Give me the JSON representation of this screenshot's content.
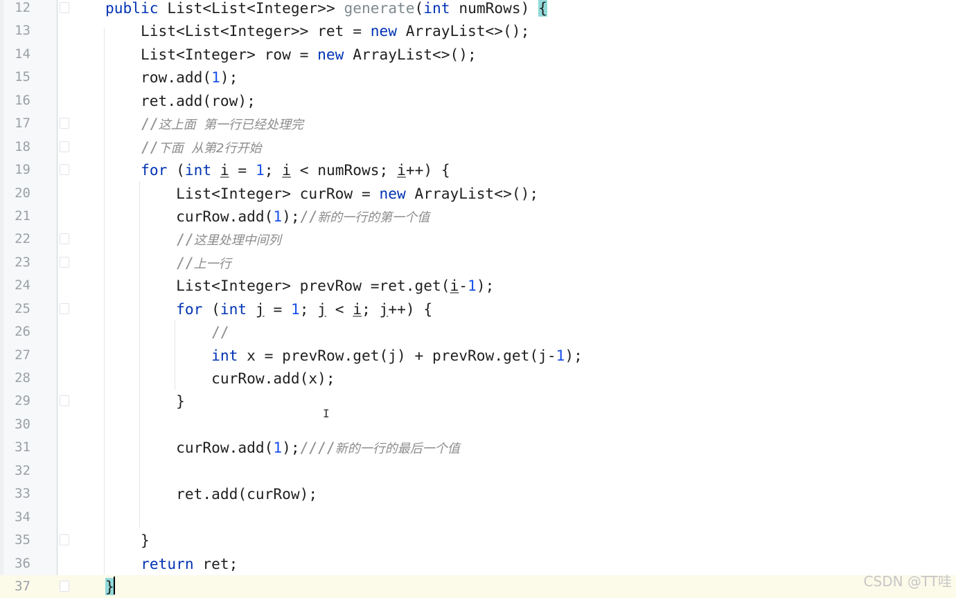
{
  "editor": {
    "current_line": 37,
    "lines": [
      {
        "num": "12",
        "fold": true,
        "tokens": [
          {
            "t": "    "
          },
          {
            "t": "public",
            "c": "kw"
          },
          {
            "t": " List<List<Integer>> "
          },
          {
            "t": "generate",
            "c": "fn"
          },
          {
            "t": "("
          },
          {
            "t": "int",
            "c": "kw"
          },
          {
            "t": " numRows) "
          },
          {
            "t": "{",
            "c": "br"
          }
        ]
      },
      {
        "num": "13",
        "tokens": [
          {
            "t": "        List<List<Integer>> ret = "
          },
          {
            "t": "new",
            "c": "kw"
          },
          {
            "t": " ArrayList<>();"
          }
        ]
      },
      {
        "num": "14",
        "tokens": [
          {
            "t": "        List<Integer> row = "
          },
          {
            "t": "new",
            "c": "kw"
          },
          {
            "t": " ArrayList<>();"
          }
        ]
      },
      {
        "num": "15",
        "tokens": [
          {
            "t": "        row.add("
          },
          {
            "t": "1",
            "c": "num"
          },
          {
            "t": ");"
          }
        ]
      },
      {
        "num": "16",
        "tokens": [
          {
            "t": "        ret.add(row);"
          }
        ]
      },
      {
        "num": "17",
        "fold": true,
        "tokens": [
          {
            "t": "        "
          },
          {
            "t": "//",
            "c": "cms"
          },
          {
            "t": "这上面  第一行已经处理完",
            "c": "cm"
          }
        ]
      },
      {
        "num": "18",
        "fold": true,
        "tokens": [
          {
            "t": "        "
          },
          {
            "t": "//",
            "c": "cms"
          },
          {
            "t": "下面  从第2行开始",
            "c": "cm"
          }
        ]
      },
      {
        "num": "19",
        "fold": true,
        "tokens": [
          {
            "t": "        "
          },
          {
            "t": "for",
            "c": "kw"
          },
          {
            "t": " ("
          },
          {
            "t": "int",
            "c": "kw"
          },
          {
            "t": " "
          },
          {
            "t": "i",
            "c": "u"
          },
          {
            "t": " = "
          },
          {
            "t": "1",
            "c": "num"
          },
          {
            "t": "; "
          },
          {
            "t": "i",
            "c": "u"
          },
          {
            "t": " < numRows; "
          },
          {
            "t": "i",
            "c": "u"
          },
          {
            "t": "++) {"
          }
        ]
      },
      {
        "num": "20",
        "tokens": [
          {
            "t": "            List<Integer> curRow = "
          },
          {
            "t": "new",
            "c": "kw"
          },
          {
            "t": " ArrayList<>();"
          }
        ]
      },
      {
        "num": "21",
        "tokens": [
          {
            "t": "            curRow.add("
          },
          {
            "t": "1",
            "c": "num"
          },
          {
            "t": ");"
          },
          {
            "t": "//",
            "c": "cms"
          },
          {
            "t": "新的一行的第一个值",
            "c": "cm"
          }
        ]
      },
      {
        "num": "22",
        "fold": true,
        "tokens": [
          {
            "t": "            "
          },
          {
            "t": "//",
            "c": "cms"
          },
          {
            "t": "这里处理中间列",
            "c": "cm"
          }
        ]
      },
      {
        "num": "23",
        "fold": true,
        "tokens": [
          {
            "t": "            "
          },
          {
            "t": "//",
            "c": "cms"
          },
          {
            "t": "上一行",
            "c": "cm"
          }
        ]
      },
      {
        "num": "24",
        "tokens": [
          {
            "t": "            List<Integer> prevRow =ret.get("
          },
          {
            "t": "i",
            "c": "u"
          },
          {
            "t": "-"
          },
          {
            "t": "1",
            "c": "num"
          },
          {
            "t": ");"
          }
        ]
      },
      {
        "num": "25",
        "fold": true,
        "tokens": [
          {
            "t": "            "
          },
          {
            "t": "for",
            "c": "kw"
          },
          {
            "t": " ("
          },
          {
            "t": "int",
            "c": "kw"
          },
          {
            "t": " "
          },
          {
            "t": "j",
            "c": "u"
          },
          {
            "t": " = "
          },
          {
            "t": "1",
            "c": "num"
          },
          {
            "t": "; "
          },
          {
            "t": "j",
            "c": "u"
          },
          {
            "t": " < "
          },
          {
            "t": "i",
            "c": "u"
          },
          {
            "t": "; "
          },
          {
            "t": "j",
            "c": "u"
          },
          {
            "t": "++) {"
          }
        ]
      },
      {
        "num": "26",
        "tokens": [
          {
            "t": "                "
          },
          {
            "t": "//",
            "c": "cms"
          }
        ]
      },
      {
        "num": "27",
        "tokens": [
          {
            "t": "                "
          },
          {
            "t": "int",
            "c": "kw"
          },
          {
            "t": " x = prevRow.get(j) + prevRow.get(j-"
          },
          {
            "t": "1",
            "c": "num"
          },
          {
            "t": ");"
          }
        ]
      },
      {
        "num": "28",
        "tokens": [
          {
            "t": "                curRow.add(x);"
          }
        ]
      },
      {
        "num": "29",
        "fold": true,
        "tokens": [
          {
            "t": "            }"
          }
        ]
      },
      {
        "num": "30",
        "tokens": []
      },
      {
        "num": "31",
        "tokens": [
          {
            "t": "            curRow.add("
          },
          {
            "t": "1",
            "c": "num"
          },
          {
            "t": ");"
          },
          {
            "t": "////",
            "c": "cms"
          },
          {
            "t": "新的一行的最后一个值",
            "c": "cm"
          }
        ]
      },
      {
        "num": "32",
        "tokens": []
      },
      {
        "num": "33",
        "tokens": [
          {
            "t": "            ret.add(curRow);"
          }
        ]
      },
      {
        "num": "34",
        "tokens": []
      },
      {
        "num": "35",
        "fold": true,
        "tokens": [
          {
            "t": "        }"
          }
        ]
      },
      {
        "num": "36",
        "tokens": [
          {
            "t": "        "
          },
          {
            "t": "return",
            "c": "kw"
          },
          {
            "t": " ret;"
          }
        ]
      },
      {
        "num": "37",
        "fold": true,
        "tokens": [
          {
            "t": "    "
          },
          {
            "t": "}",
            "c": "br"
          }
        ]
      }
    ]
  },
  "watermark": "CSDN @TT哇",
  "colors": {
    "keyword": "#0033b3",
    "number": "#1750eb",
    "comment": "#8c8c8c",
    "brace_match": "#93d9d9",
    "current_line": "#fcfae9"
  }
}
